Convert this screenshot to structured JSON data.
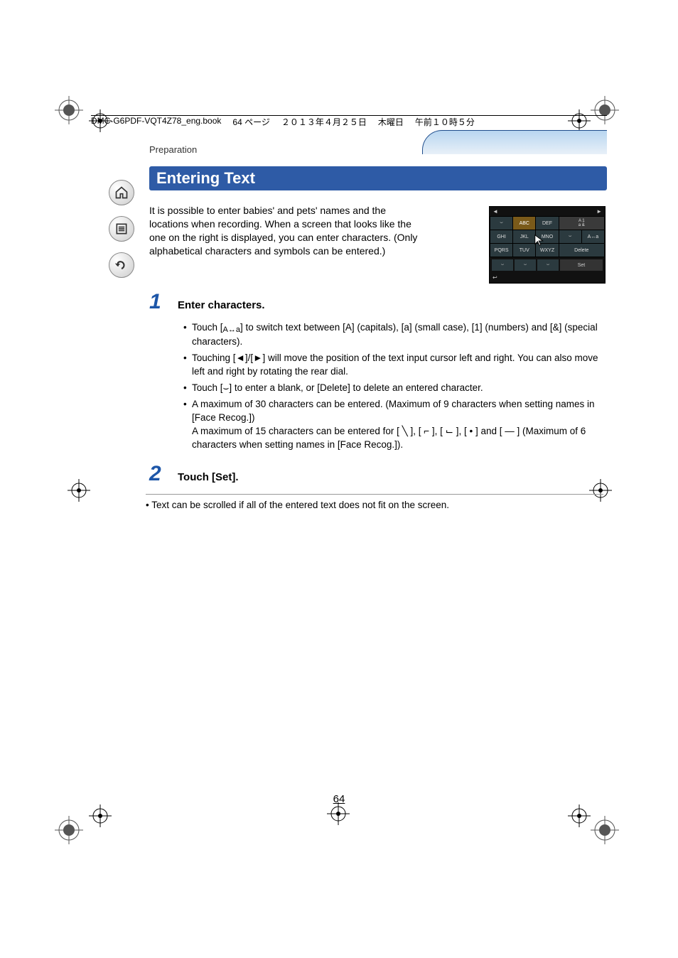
{
  "header": {
    "filename": "DMC-G6PDF-VQT4Z78_eng.book",
    "pageinfo": "64 ページ",
    "date": "２０１３年４月２５日",
    "weekday": "木曜日",
    "time": "午前１０時５分"
  },
  "section_label": "Preparation",
  "title": "Entering Text",
  "intro": "It is possible to enter babies' and pets' names and the locations when recording. When a screen that looks like the one on the right is displayed, you can enter characters. (Only alphabetical characters and symbols can be entered.)",
  "sidenav": {
    "home_label": "home-icon",
    "toc_label": "toc-icon",
    "back_label": "back-icon"
  },
  "keypad": {
    "top_left": "◄",
    "top_right": "►",
    "row1": [
      "⌣",
      "ABC",
      "DEF"
    ],
    "row1_side_top": "A   1",
    "row1_side_bottom": "a   &",
    "row2": [
      "GHI",
      "JKL",
      "MNO",
      "⌣"
    ],
    "row2_side": "A↔a",
    "row3": [
      "PQRS",
      "TUV",
      "WXYZ"
    ],
    "row3_side": "Delete",
    "bottom": [
      "⌣",
      "⌣",
      "⌣"
    ],
    "set": "Set",
    "return": "↩"
  },
  "step1": {
    "num": "1",
    "title": "Enter characters.",
    "bullets": [
      "Touch [    ] to switch text between [A] (capitals), [a] (small case), [1] (numbers) and [&] (special characters).",
      "Touching [◄]/[►] will move the position of the text input cursor left and right. You can also move left and right by rotating the rear dial.",
      "Touch [⌣] to enter a blank, or [Delete] to delete an entered character.",
      "A maximum of 30 characters can be entered. (Maximum of 9 characters when setting names in [Face Recog.])\nA maximum of 15 characters can be entered for [ ╲ ], [ ⌐ ], [ ⌙ ], [ • ] and [ — ] (Maximum of 6 characters when setting names in [Face Recog.])."
    ],
    "icon_caseswitch": "A↔a"
  },
  "step2": {
    "num": "2",
    "title": "Touch [Set]."
  },
  "note": "• Text can be scrolled if all of the entered text does not fit on the screen.",
  "page_number": "64"
}
